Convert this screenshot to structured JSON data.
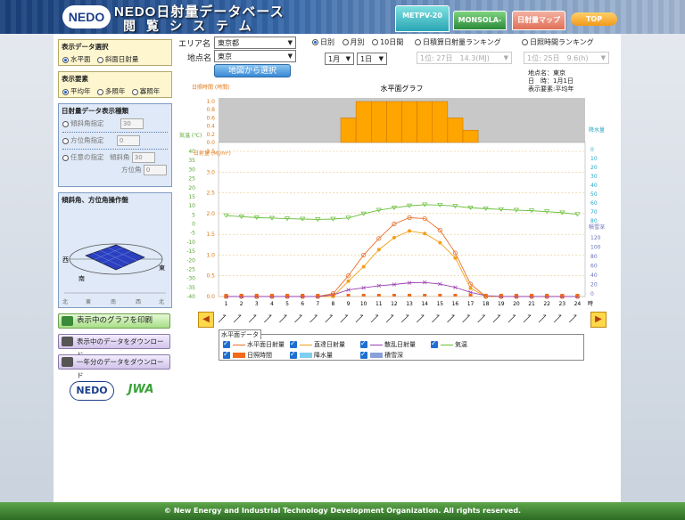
{
  "header": {
    "logo_text": "NEDO",
    "title": "NEDO日射量データベース",
    "subtitle": "閲覧システム",
    "tabs": [
      {
        "label": "METPV-20"
      },
      {
        "label": "MONSOLA-20"
      },
      {
        "label": "日射量マップ"
      },
      {
        "label": "TOP"
      }
    ]
  },
  "left": {
    "display_data": {
      "title": "表示データ選択",
      "options": [
        {
          "label": "水平面",
          "selected": true
        },
        {
          "label": "斜面日射量",
          "selected": false
        }
      ]
    },
    "display_element": {
      "title": "表示要素",
      "options": [
        {
          "label": "平均年",
          "selected": true
        },
        {
          "label": "多照年",
          "selected": false
        },
        {
          "label": "寡照年",
          "selected": false
        }
      ]
    },
    "irradiance_type": {
      "title": "日射量データ表示種類",
      "tilt_label": "傾斜角指定",
      "tilt_value": "30",
      "azimuth_label": "方位角指定",
      "azimuth_value": "0",
      "any_label": "任意の指定",
      "any_tilt_label": "傾斜角",
      "any_tilt_value": "30",
      "any_azimuth_label": "方位角",
      "any_azimuth_value": "0"
    },
    "operation": {
      "title": "傾斜角、方位角操作盤",
      "west": "西",
      "east": "東",
      "south": "南",
      "ruler": [
        "北",
        "東",
        "南",
        "西",
        "北"
      ]
    },
    "print_btn": "表示中のグラフを印刷",
    "download_btn": "表示中のデータをダウンロード",
    "download_year_btn": "一年分のデータをダウンロード",
    "logo_bottom_1": "NEDO",
    "logo_bottom_2": "JWA"
  },
  "controls": {
    "area_label": "エリア名",
    "area_value": "東京都",
    "point_label": "地点名",
    "point_value": "東京",
    "map_button": "地図から選択",
    "period_options": [
      {
        "label": "日別",
        "selected": true
      },
      {
        "label": "月別",
        "selected": false
      },
      {
        "label": "10日間",
        "selected": false
      }
    ],
    "month_value": "1月",
    "day_value": "1日",
    "ranking1_label": "日積算日射量ランキング",
    "ranking1_value": "1位: 27日　14.3(MJ)",
    "ranking2_label": "日照時間ランキング",
    "ranking2_value": "1位: 25日　9.6(h)",
    "info": {
      "point": "地点名：東京",
      "date": "日　時：1月1日",
      "element": "表示要素:平均年"
    }
  },
  "chart_data": {
    "type": "line",
    "title": "水平面グラフ",
    "x": [
      1,
      2,
      3,
      4,
      5,
      6,
      7,
      8,
      9,
      10,
      11,
      12,
      13,
      14,
      15,
      16,
      17,
      18,
      19,
      20,
      21,
      22,
      23,
      24
    ],
    "xunit": "時",
    "sunshine_hours": {
      "name": "日照時間",
      "ylabel": "日照時間 (時間)",
      "ylim": [
        0,
        1.0
      ],
      "values": [
        0,
        0,
        0,
        0,
        0,
        0,
        0,
        0,
        0.6,
        1.0,
        1.0,
        1.0,
        1.0,
        1.0,
        1.0,
        0.6,
        0.3,
        0,
        0,
        0,
        0,
        0,
        0,
        0
      ]
    },
    "irradiance_axis": {
      "ylabel": "日射量 (MJ/m²)",
      "ylim": [
        0,
        3.5
      ]
    },
    "temperature_axis": {
      "ylabel": "気温 (℃)",
      "ylim": [
        -40,
        40
      ]
    },
    "precip_axis": {
      "ylabel": "降水量 (mm)",
      "ticks": [
        0,
        10,
        20,
        30,
        40,
        50,
        60,
        70,
        80
      ]
    },
    "snow_axis": {
      "ylabel": "積雪深 (cm)",
      "ticks": [
        0,
        20,
        40,
        60,
        80,
        100,
        120
      ]
    },
    "series": [
      {
        "name": "水平面日射量",
        "color": "#e8702a",
        "values": [
          0,
          0,
          0,
          0,
          0,
          0,
          0,
          0.07,
          0.5,
          1.0,
          1.4,
          1.75,
          1.9,
          1.88,
          1.6,
          1.05,
          0.3,
          0,
          0,
          0,
          0,
          0,
          0,
          0
        ]
      },
      {
        "name": "直達日射量",
        "color": "#f2a01a",
        "values": [
          0,
          0,
          0,
          0,
          0,
          0,
          0,
          0,
          0.37,
          0.72,
          1.13,
          1.42,
          1.58,
          1.52,
          1.3,
          0.93,
          0.2,
          0,
          0,
          0,
          0,
          0,
          0,
          0
        ]
      },
      {
        "name": "散乱日射量",
        "color": "#9a3fb0",
        "values": [
          0,
          0,
          0,
          0,
          0,
          0,
          0,
          0.04,
          0.16,
          0.21,
          0.26,
          0.29,
          0.33,
          0.34,
          0.3,
          0.22,
          0.1,
          0.02,
          0,
          0,
          0,
          0,
          0,
          0
        ]
      },
      {
        "name": "気温",
        "color": "#6abf3a",
        "values": [
          4.6,
          4.0,
          3.5,
          3.2,
          2.9,
          2.7,
          2.5,
          2.7,
          3.3,
          5.6,
          7.6,
          8.9,
          10.0,
          10.6,
          10.4,
          9.8,
          8.9,
          8.4,
          8.0,
          7.6,
          7.3,
          6.8,
          6.2,
          5.3
        ]
      }
    ],
    "legend": {
      "title": "水平面データ",
      "items": [
        "水平面日射量",
        "直達日射量",
        "散乱日射量",
        "気温",
        "日照時間",
        "降水量",
        "積雪深"
      ]
    }
  },
  "footer": "© New Energy and Industrial Technology Development Organization. All rights reserved."
}
